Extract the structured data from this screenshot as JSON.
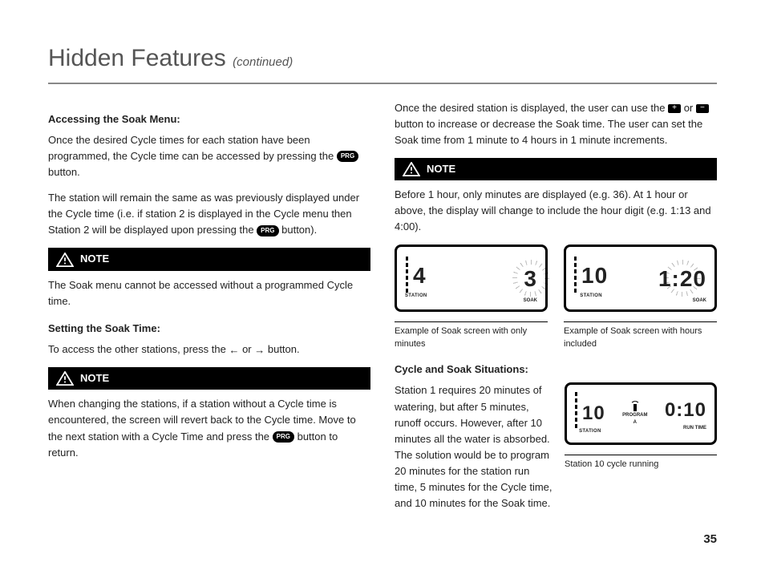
{
  "header": {
    "title": "Hidden Features",
    "continued": "(continued)"
  },
  "left": {
    "h1": "Accessing the Soak Menu:",
    "p1a": "Once the desired Cycle times for each station have been programmed, the Cycle time can be accessed by pressing the ",
    "prgBtn": "PRG",
    "p1b": " button.",
    "p2a": "The station will remain the same as was previously displayed under the Cycle time (i.e. if station 2 is displayed in the Cycle menu then Station 2 will be displayed upon pressing the ",
    "p2b": " button).",
    "note1Label": "NOTE",
    "note1Text": "The Soak menu cannot be accessed without a programmed Cycle time.",
    "h2": "Setting the Soak Time:",
    "p3a": "To access the other stations, press the ",
    "p3b": " or ",
    "p3c": " button.",
    "note2Label": "NOTE",
    "note2Text": "When changing the stations, if a station without a Cycle time is encountered, the screen will revert back to the Cycle time. Move to the next station with a Cycle Time and press the ",
    "note2Text2": " button to return."
  },
  "right": {
    "p1a": "Once the desired station is displayed, the user can use the ",
    "p1b": " or ",
    "p1c": " button to increase or decrease the Soak time. The user can set the Soak time from 1 minute to 4 hours in 1 minute increments.",
    "note1Label": "NOTE",
    "note1Text": "Before 1 hour, only minutes are displayed (e.g. 36). At 1 hour or above, the display will change to include the hour digit (e.g. 1:13 and 4:00).",
    "lcd1": {
      "station": "4",
      "stationLabel": "STATION",
      "value": "3",
      "soakLabel": "SOAK"
    },
    "lcd1Caption": "Example of Soak screen with only minutes",
    "lcd2": {
      "station": "10",
      "stationLabel": "STATION",
      "value": "1:20",
      "soakLabel": "SOAK"
    },
    "lcd2Caption": "Example of Soak screen with hours included",
    "h3": "Cycle and Soak Situations:",
    "cycleText": "Station 1 requires 20 minutes of watering, but after 5 minutes, runoff occurs. However, after 10 minutes all the water is absorbed. The solution would be to program 20 minutes for the station run time, 5 minutes for the Cycle time, and 10 minutes for the Soak time.",
    "lcd3": {
      "station": "10",
      "stationLabel": "STATION",
      "program": "PROGRAM",
      "programLetter": "A",
      "value": "0:10",
      "runLabel": "RUN TIME"
    },
    "lcd3Caption": "Station 10 cycle running"
  },
  "icons": {
    "plus": "+",
    "minus": "−",
    "left": "←",
    "right": "→"
  },
  "pageNumber": "35"
}
